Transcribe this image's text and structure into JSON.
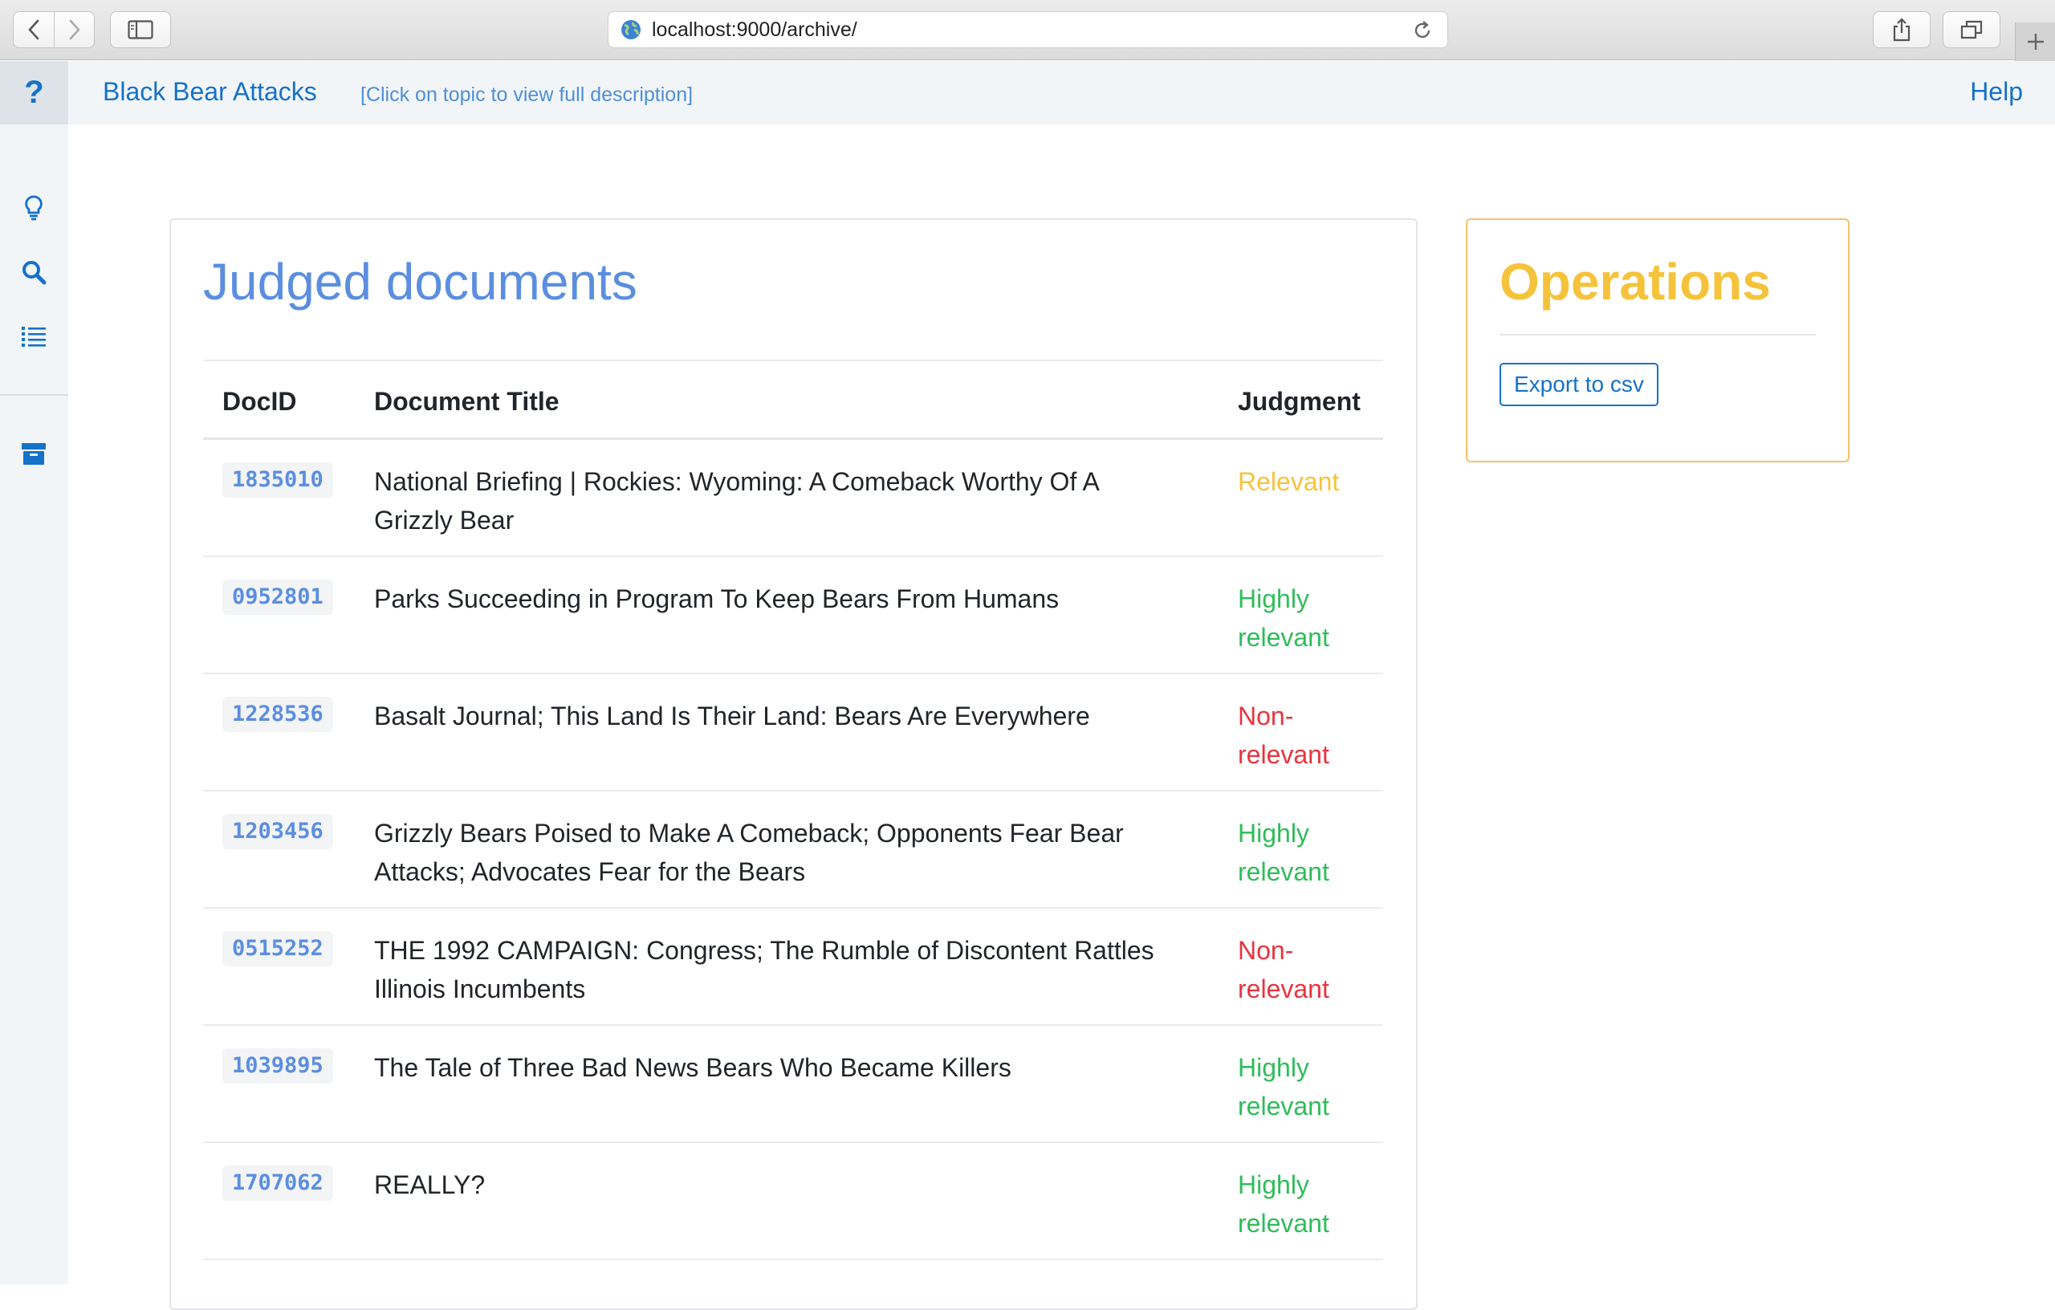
{
  "browser": {
    "url": "localhost:9000/archive/"
  },
  "navbar": {
    "help_icon_label": "?",
    "topic_title": "Black Bear Attacks",
    "topic_hint": "[Click on topic to view full description]",
    "help_label": "Help"
  },
  "sidebar": {
    "items": [
      {
        "icon": "lightbulb-icon"
      },
      {
        "icon": "search-icon"
      },
      {
        "icon": "list-icon"
      },
      {
        "icon": "archive-icon"
      }
    ]
  },
  "judged": {
    "title": "Judged documents",
    "columns": {
      "docid": "DocID",
      "title": "Document Title",
      "judgment": "Judgment"
    },
    "rows": [
      {
        "docid": "1835010",
        "title": "National Briefing | Rockies: Wyoming: A Comeback Worthy Of A Grizzly Bear",
        "judgment": "Relevant",
        "color": "#f5c33b"
      },
      {
        "docid": "0952801",
        "title": "Parks Succeeding in Program To Keep Bears From Humans",
        "judgment": "Highly relevant",
        "color": "#2ebd59"
      },
      {
        "docid": "1228536",
        "title": "Basalt Journal; This Land Is Their Land: Bears Are Everywhere",
        "judgment": "Non-relevant",
        "color": "#e8343f"
      },
      {
        "docid": "1203456",
        "title": "Grizzly Bears Poised to Make A Comeback; Opponents Fear Bear Attacks; Advocates Fear for the Bears",
        "judgment": "Highly relevant",
        "color": "#2ebd59"
      },
      {
        "docid": "0515252",
        "title": "THE 1992 CAMPAIGN: Congress; The Rumble of Discontent Rattles Illinois Incumbents",
        "judgment": "Non-relevant",
        "color": "#e8343f"
      },
      {
        "docid": "1039895",
        "title": "The Tale of Three Bad News Bears Who Became Killers",
        "judgment": "Highly relevant",
        "color": "#2ebd59"
      },
      {
        "docid": "1707062",
        "title": "REALLY?",
        "judgment": "Highly relevant",
        "color": "#2ebd59"
      }
    ]
  },
  "operations": {
    "title": "Operations",
    "export_label": "Export to csv"
  },
  "colors": {
    "accent": "#1472c9",
    "title_blue": "#5b8ee0",
    "operations_yellow": "#f5c33b"
  }
}
